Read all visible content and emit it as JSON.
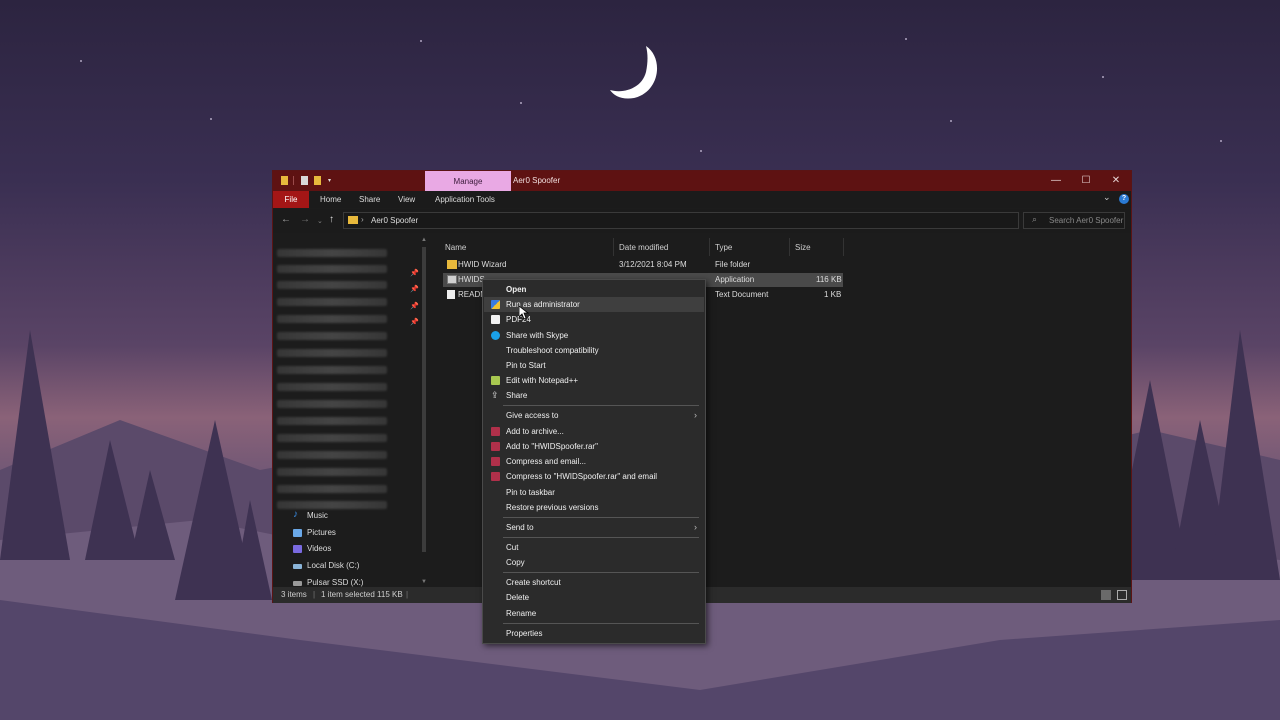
{
  "window": {
    "title": "Aer0 Spoofer",
    "manage_tab": "Manage",
    "controls": {
      "minimize": "—",
      "maximize": "☐",
      "close": "✕"
    }
  },
  "ribbon": {
    "tabs": [
      "File",
      "Home",
      "Share",
      "View",
      "Application Tools"
    ]
  },
  "address": {
    "path": "Aer0 Spoofer",
    "search_placeholder": "Search Aer0 Spoofer"
  },
  "nav_pane": {
    "items": [
      {
        "label": "Music",
        "icon": "music-icon",
        "color": "#3a8ee6"
      },
      {
        "label": "Pictures",
        "icon": "pictures-icon",
        "color": "#6aa8e8"
      },
      {
        "label": "Videos",
        "icon": "videos-icon",
        "color": "#7a6ae0"
      },
      {
        "label": "Local Disk (C:)",
        "icon": "drive-icon",
        "color": "#8ab4d8"
      },
      {
        "label": "Pulsar SSD (X:)",
        "icon": "drive-icon",
        "color": "#9a9a9a"
      }
    ]
  },
  "columns": [
    "Name",
    "Date modified",
    "Type",
    "Size"
  ],
  "files": [
    {
      "name": "HWID Wizard",
      "date": "3/12/2021 8:04 PM",
      "type": "File folder",
      "size": "",
      "icon": "folder-icon"
    },
    {
      "name": "HWIDS",
      "date": "",
      "type": "Application",
      "size": "116 KB",
      "icon": "application-icon",
      "selected": true
    },
    {
      "name": "READM",
      "date": "",
      "type": "Text Document",
      "size": "1 KB",
      "icon": "text-file-icon"
    }
  ],
  "status": {
    "count": "3 items",
    "selection": "1 item selected  115 KB"
  },
  "context_menu": {
    "items": [
      {
        "label": "Open",
        "bold": true
      },
      {
        "label": "Run as administrator",
        "icon": "shield-icon",
        "highlight": true
      },
      {
        "label": "PDF24",
        "icon": "pdf24-icon"
      },
      {
        "label": "Share with Skype",
        "icon": "skype-icon"
      },
      {
        "label": "Troubleshoot compatibility"
      },
      {
        "label": "Pin to Start"
      },
      {
        "label": "Edit with Notepad++",
        "icon": "notepadpp-icon"
      },
      {
        "label": "Share",
        "icon": "share-icon"
      },
      {
        "label": "Give access to",
        "submenu": true
      },
      {
        "label": "Add to archive...",
        "icon": "winrar-icon"
      },
      {
        "label": "Add to \"HWIDSpoofer.rar\"",
        "icon": "winrar-icon"
      },
      {
        "label": "Compress and email...",
        "icon": "winrar-icon"
      },
      {
        "label": "Compress to \"HWIDSpoofer.rar\" and email",
        "icon": "winrar-icon"
      },
      {
        "label": "Pin to taskbar"
      },
      {
        "label": "Restore previous versions"
      },
      {
        "label": "Send to",
        "submenu": true
      },
      {
        "label": "Cut"
      },
      {
        "label": "Copy"
      },
      {
        "label": "Create shortcut"
      },
      {
        "label": "Delete"
      },
      {
        "label": "Rename"
      },
      {
        "label": "Properties"
      }
    ],
    "submenu_arrow": "›"
  },
  "colors": {
    "titlebar": "#5e1212",
    "accent_file_tab": "#a41616",
    "manage_tab": "#e9a9e4",
    "menu_bg": "#2b2b2b"
  }
}
